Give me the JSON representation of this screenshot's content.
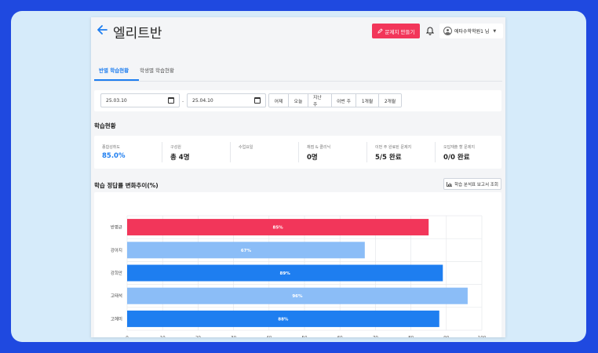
{
  "header": {
    "title": "엘리트반",
    "create_button": "문제지 만들기",
    "user_label": "에타수학학원1 님"
  },
  "tabs": [
    {
      "label": "반별 학습현황",
      "active": true
    },
    {
      "label": "학생별 학습현황",
      "active": false
    }
  ],
  "filters": {
    "start_date": "25.03.10",
    "end_date": "25.04.10",
    "separator": "-",
    "ranges": [
      "어제",
      "오늘",
      "지난 주",
      "이번 주",
      "1개월",
      "2개월"
    ]
  },
  "summary": {
    "title": "학습현황",
    "stats": [
      {
        "label": "종합성취도",
        "value": "85.0%",
        "accent": true
      },
      {
        "label": "구성원",
        "value": "총 4명",
        "accent": false
      },
      {
        "label": "수업요일",
        "value": "",
        "accent": false
      },
      {
        "label": "채점 & 클리닉",
        "value": "0명",
        "accent": false
      },
      {
        "label": "이번 주 완료된 문제지",
        "value": "5/5 완료",
        "accent": false
      },
      {
        "label": "오답재출 할 문제지",
        "value": "0/0 완료",
        "accent": false
      }
    ]
  },
  "trend": {
    "title": "학습 정답률 변화추이(%)",
    "report_button": "학습 분석표 보고서 조회"
  },
  "colors": {
    "accent": "#1e7ef0",
    "brand_red": "#f2365a",
    "bar_light": "#8bbdf7"
  },
  "chart_data": {
    "type": "bar",
    "orientation": "horizontal",
    "categories": [
      "반평균",
      "강아지",
      "강희안",
      "고태석",
      "고혜미"
    ],
    "values": [
      85,
      67,
      89,
      96,
      88
    ],
    "value_labels": [
      "85%",
      "67%",
      "89%",
      "96%",
      "88%"
    ],
    "bar_colors": [
      "#f2365a",
      "#8bbdf7",
      "#1e7ef0",
      "#8bbdf7",
      "#1e7ef0"
    ],
    "xlim": [
      0,
      100
    ],
    "xticks": [
      0,
      10,
      20,
      30,
      40,
      50,
      60,
      70,
      80,
      90,
      100
    ],
    "grid": true
  }
}
